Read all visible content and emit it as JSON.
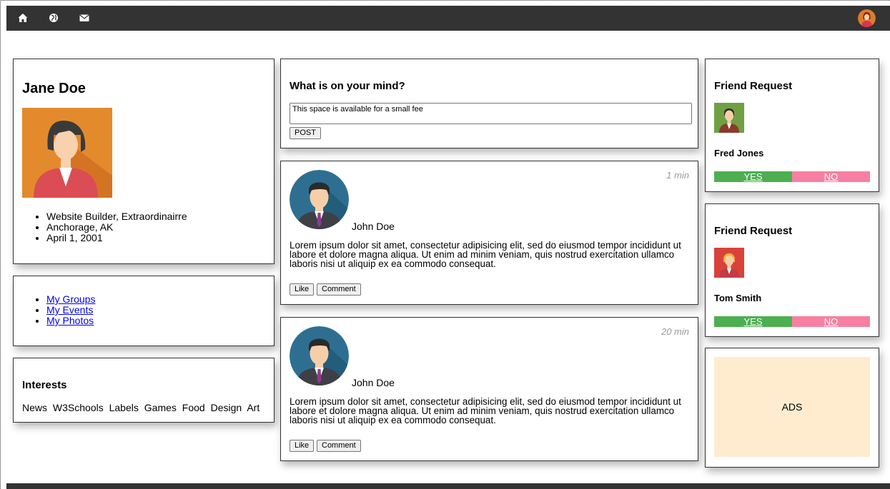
{
  "nav": {
    "icons": [
      "home-icon",
      "globe-icon",
      "envelope-icon"
    ]
  },
  "profile": {
    "name": "Jane Doe",
    "info": [
      "Website Builder, Extraordinairre",
      "Anchorage, AK",
      "April 1, 2001"
    ]
  },
  "links": [
    "My Groups",
    "My Events",
    "My Photos"
  ],
  "interests": {
    "title": "Interests",
    "tags": [
      "News",
      "W3Schools",
      "Labels",
      "Games",
      "Food",
      "Design",
      "Art"
    ]
  },
  "composer": {
    "title": "What is on your mind?",
    "value": "This space is available for a small fee",
    "post_label": "POST"
  },
  "posts": [
    {
      "time": "1 min",
      "author": "John Doe",
      "text": "Lorem ipsum dolor sit amet, consectetur adipisicing elit, sed do eiusmod tempor incididunt ut labore et dolore magna aliqua. Ut enim ad minim veniam, quis nostrud exercitation ullamco laboris nisi ut aliquip ex ea commodo consequat.",
      "like_label": "Like",
      "comment_label": "Comment"
    },
    {
      "time": "20 min",
      "author": "John Doe",
      "text": "Lorem ipsum dolor sit amet, consectetur adipisicing elit, sed do eiusmod tempor incididunt ut labore et dolore magna aliqua. Ut enim ad minim veniam, quis nostrud exercitation ullamco laboris nisi ut aliquip ex ea commodo consequat.",
      "like_label": "Like",
      "comment_label": "Comment"
    }
  ],
  "friend_requests": [
    {
      "title": "Friend Request",
      "name": "Fred Jones",
      "yes": "YES",
      "no": "NO"
    },
    {
      "title": "Friend Request",
      "name": "Tom Smith",
      "yes": "YES",
      "no": "NO"
    }
  ],
  "ads": {
    "label": "ADS"
  },
  "colors": {
    "topbar": "#333333",
    "yes": "#4CAF50",
    "no": "#f87fa1",
    "ads_bg": "#ffeccf"
  }
}
